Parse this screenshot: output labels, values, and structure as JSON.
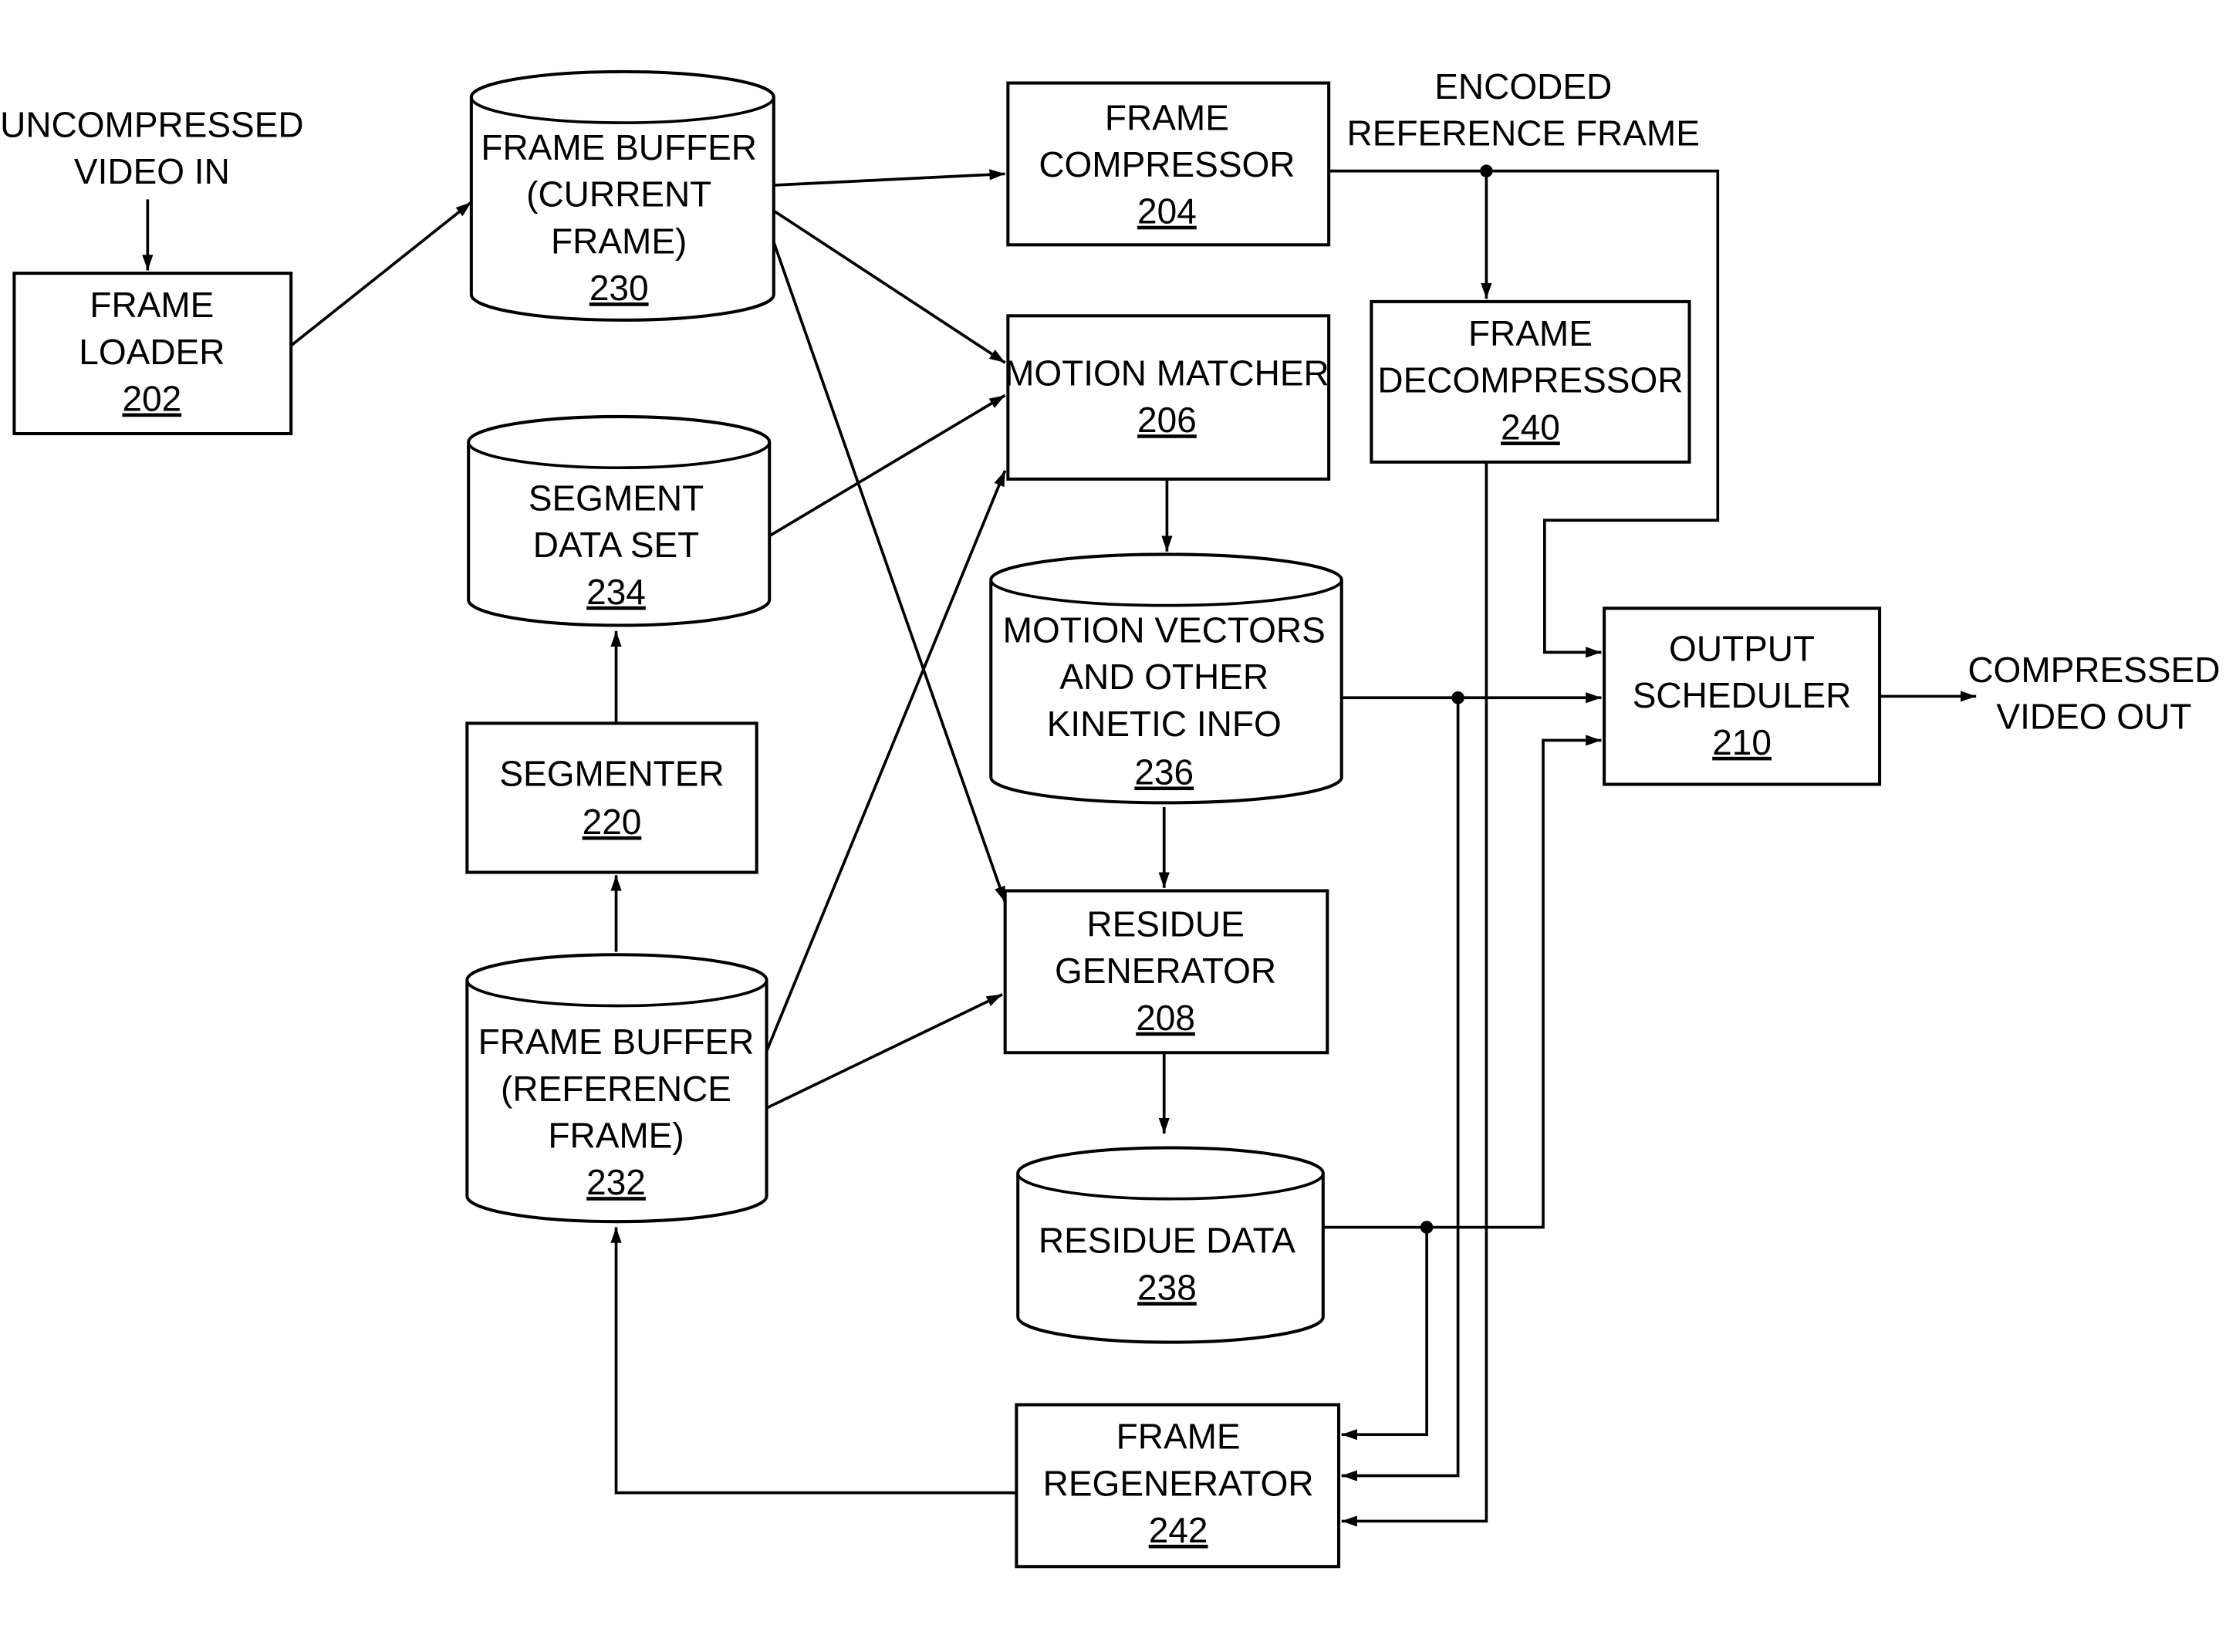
{
  "diagram": {
    "type": "block-diagram",
    "inputs": {
      "uncompressed_video_in": [
        "UNCOMPRESSED",
        "VIDEO IN"
      ],
      "compressed_video_out": [
        "COMPRESSED",
        "VIDEO OUT"
      ],
      "encoded_reference_frame": [
        "ENCODED",
        "REFERENCE FRAME"
      ]
    },
    "nodes": {
      "frame_loader": {
        "lines": [
          "FRAME",
          "LOADER"
        ],
        "ref": "202",
        "shape": "box"
      },
      "frame_buffer_current": {
        "lines": [
          "FRAME BUFFER",
          "(CURRENT",
          "FRAME)"
        ],
        "ref": "230",
        "shape": "cylinder"
      },
      "frame_compressor": {
        "lines": [
          "FRAME",
          "COMPRESSOR"
        ],
        "ref": "204",
        "shape": "box"
      },
      "motion_matcher": {
        "lines": [
          "MOTION MATCHER"
        ],
        "ref": "206",
        "shape": "box"
      },
      "frame_decompressor": {
        "lines": [
          "FRAME",
          "DECOMPRESSOR"
        ],
        "ref": "240",
        "shape": "box"
      },
      "segment_data_set": {
        "lines": [
          "SEGMENT",
          "DATA SET"
        ],
        "ref": "234",
        "shape": "cylinder"
      },
      "segmenter": {
        "lines": [
          "SEGMENTER"
        ],
        "ref": "220",
        "shape": "box"
      },
      "frame_buffer_reference": {
        "lines": [
          "FRAME BUFFER",
          "(REFERENCE",
          "FRAME)"
        ],
        "ref": "232",
        "shape": "cylinder"
      },
      "motion_vectors": {
        "lines": [
          "MOTION VECTORS",
          "AND OTHER",
          "KINETIC INFO"
        ],
        "ref": "236",
        "shape": "cylinder"
      },
      "residue_generator": {
        "lines": [
          "RESIDUE",
          "GENERATOR"
        ],
        "ref": "208",
        "shape": "box"
      },
      "residue_data": {
        "lines": [
          "RESIDUE DATA"
        ],
        "ref": "238",
        "shape": "cylinder"
      },
      "frame_regenerator": {
        "lines": [
          "FRAME",
          "REGENERATOR"
        ],
        "ref": "242",
        "shape": "box"
      },
      "output_scheduler": {
        "lines": [
          "OUTPUT",
          "SCHEDULER"
        ],
        "ref": "210",
        "shape": "box"
      }
    },
    "edges": [
      [
        "uncompressed_video_in",
        "frame_loader"
      ],
      [
        "frame_loader",
        "frame_buffer_current"
      ],
      [
        "frame_buffer_current",
        "frame_compressor"
      ],
      [
        "frame_buffer_current",
        "motion_matcher"
      ],
      [
        "frame_buffer_current",
        "residue_generator"
      ],
      [
        "segment_data_set",
        "motion_matcher"
      ],
      [
        "frame_buffer_reference",
        "motion_matcher"
      ],
      [
        "frame_buffer_reference",
        "residue_generator"
      ],
      [
        "frame_buffer_reference",
        "segmenter"
      ],
      [
        "segmenter",
        "segment_data_set"
      ],
      [
        "motion_matcher",
        "motion_vectors"
      ],
      [
        "motion_vectors",
        "residue_generator"
      ],
      [
        "residue_generator",
        "residue_data"
      ],
      [
        "frame_compressor",
        "frame_decompressor"
      ],
      [
        "frame_compressor",
        "output_scheduler"
      ],
      [
        "motion_vectors",
        "output_scheduler"
      ],
      [
        "residue_data",
        "output_scheduler"
      ],
      [
        "residue_data",
        "frame_regenerator"
      ],
      [
        "motion_vectors",
        "frame_regenerator"
      ],
      [
        "frame_decompressor",
        "frame_regenerator"
      ],
      [
        "frame_regenerator",
        "frame_buffer_reference"
      ],
      [
        "output_scheduler",
        "compressed_video_out"
      ]
    ]
  }
}
